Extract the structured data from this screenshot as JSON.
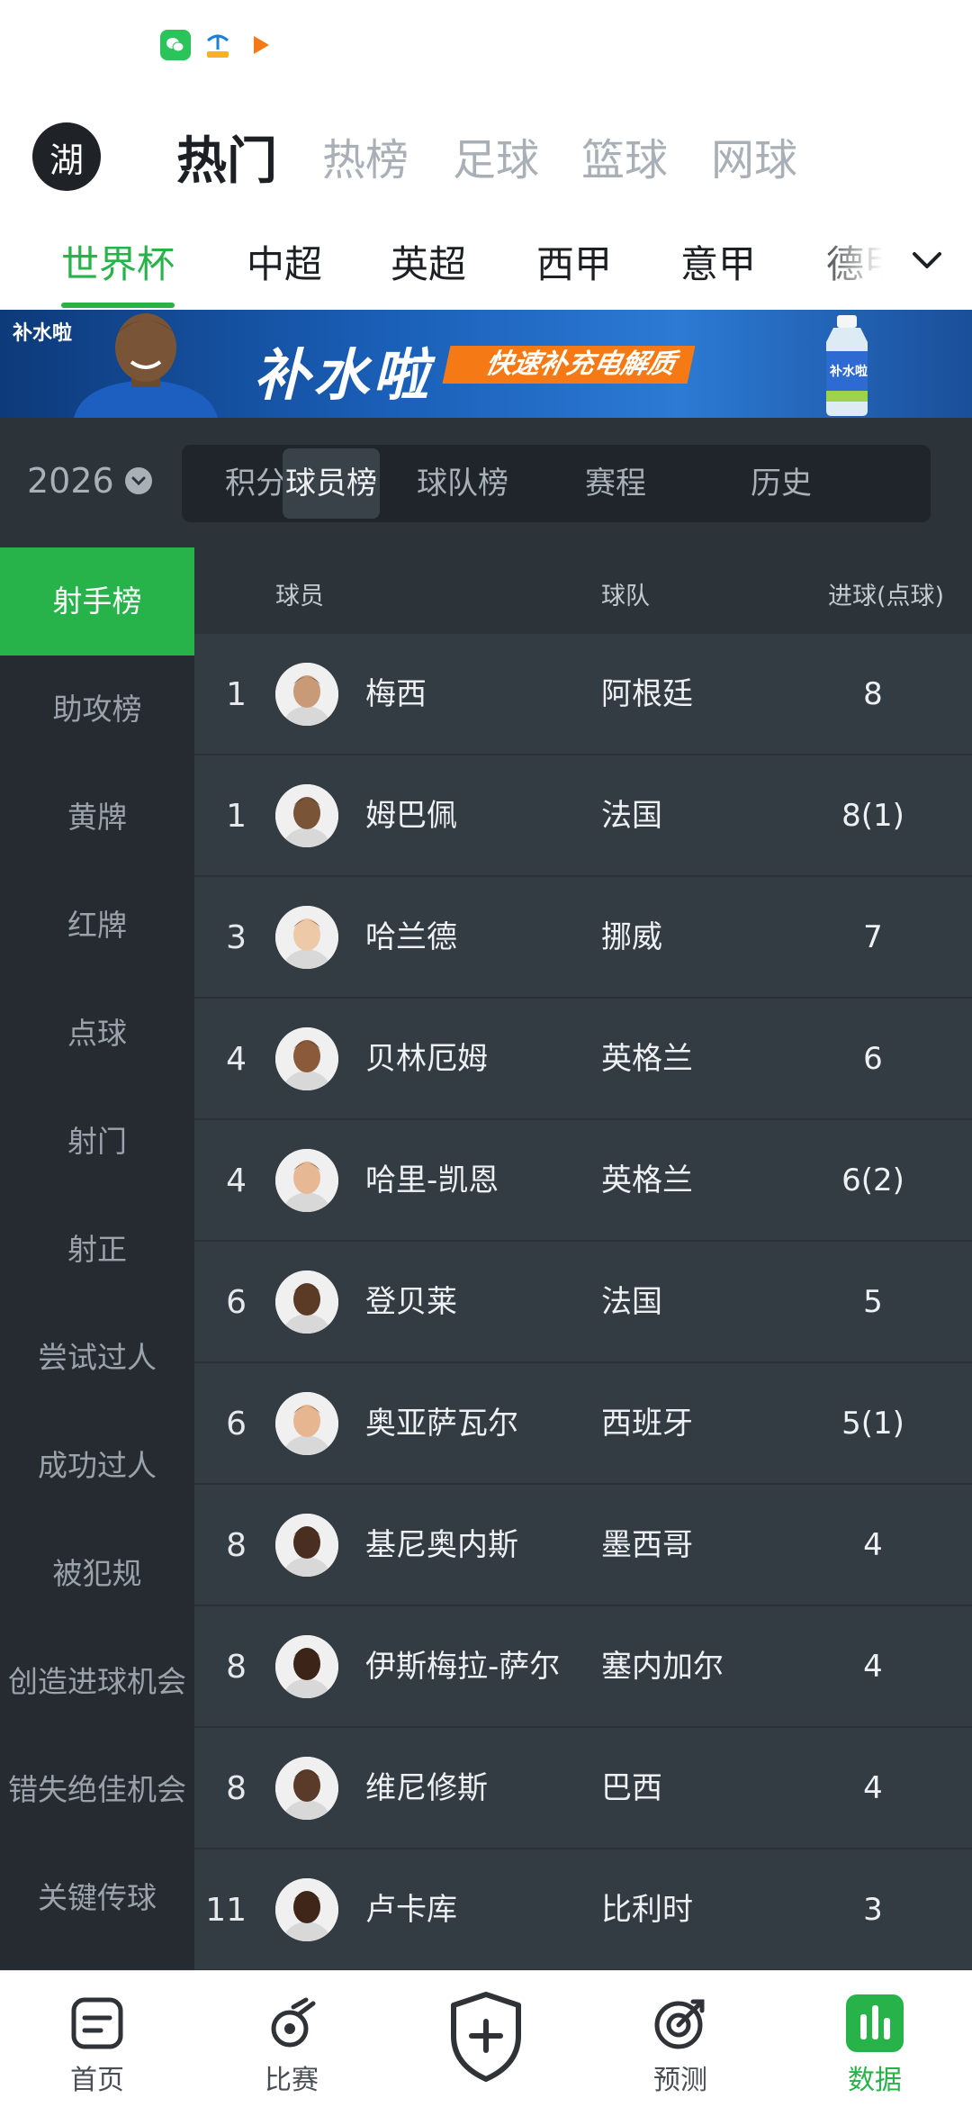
{
  "top_tabs": {
    "avatar_text": "湖",
    "items": [
      "热门",
      "热榜",
      "足球",
      "篮球",
      "网球"
    ]
  },
  "league_tabs": {
    "items": [
      "世界杯",
      "中超",
      "英超",
      "西甲",
      "意甲",
      "德甲"
    ],
    "active_index": 0
  },
  "banner": {
    "brand": "补水啦",
    "title": "补水啦",
    "slogan": "快速补充电解质",
    "bottle_label": "补水啦"
  },
  "season": {
    "year": "2026"
  },
  "segments": {
    "items": [
      "积分",
      "球员榜",
      "球队榜",
      "赛程",
      "历史"
    ],
    "active_index": 1
  },
  "categories": {
    "items": [
      "射手榜",
      "助攻榜",
      "黄牌",
      "红牌",
      "点球",
      "射门",
      "射正",
      "尝试过人",
      "成功过人",
      "被犯规",
      "创造进球机会",
      "错失绝佳机会",
      "关键传球"
    ],
    "active_index": 0
  },
  "table": {
    "headers": {
      "player": "球员",
      "team": "球队",
      "goals": "进球(点球)"
    },
    "rows": [
      {
        "rank": "1",
        "name": "梅西",
        "team": "阿根廷",
        "goals": "8"
      },
      {
        "rank": "1",
        "name": "姆巴佩",
        "team": "法国",
        "goals": "8(1)"
      },
      {
        "rank": "3",
        "name": "哈兰德",
        "team": "挪威",
        "goals": "7"
      },
      {
        "rank": "4",
        "name": "贝林厄姆",
        "team": "英格兰",
        "goals": "6"
      },
      {
        "rank": "4",
        "name": "哈里-凯恩",
        "team": "英格兰",
        "goals": "6(2)"
      },
      {
        "rank": "6",
        "name": "登贝莱",
        "team": "法国",
        "goals": "5"
      },
      {
        "rank": "6",
        "name": "奥亚萨瓦尔",
        "team": "西班牙",
        "goals": "5(1)"
      },
      {
        "rank": "8",
        "name": "基尼奥内斯",
        "team": "墨西哥",
        "goals": "4"
      },
      {
        "rank": "8",
        "name": "伊斯梅拉-萨尔",
        "team": "塞内加尔",
        "goals": "4"
      },
      {
        "rank": "8",
        "name": "维尼修斯",
        "team": "巴西",
        "goals": "4"
      },
      {
        "rank": "11",
        "name": "卢卡库",
        "team": "比利时",
        "goals": "3"
      }
    ]
  },
  "bottom_nav": {
    "items": [
      {
        "label": "首页",
        "icon": "home-icon"
      },
      {
        "label": "比赛",
        "icon": "match-whistle-icon"
      },
      {
        "label": "",
        "icon": "shield-plus-icon"
      },
      {
        "label": "预测",
        "icon": "target-icon"
      },
      {
        "label": "数据",
        "icon": "data-bars-icon"
      }
    ],
    "active_index": 4
  },
  "colors": {
    "accent_green": "#27b24a",
    "dark_bg": "#2c3339",
    "table_bg": "#343c43",
    "sidebar_bg": "#252b31"
  }
}
